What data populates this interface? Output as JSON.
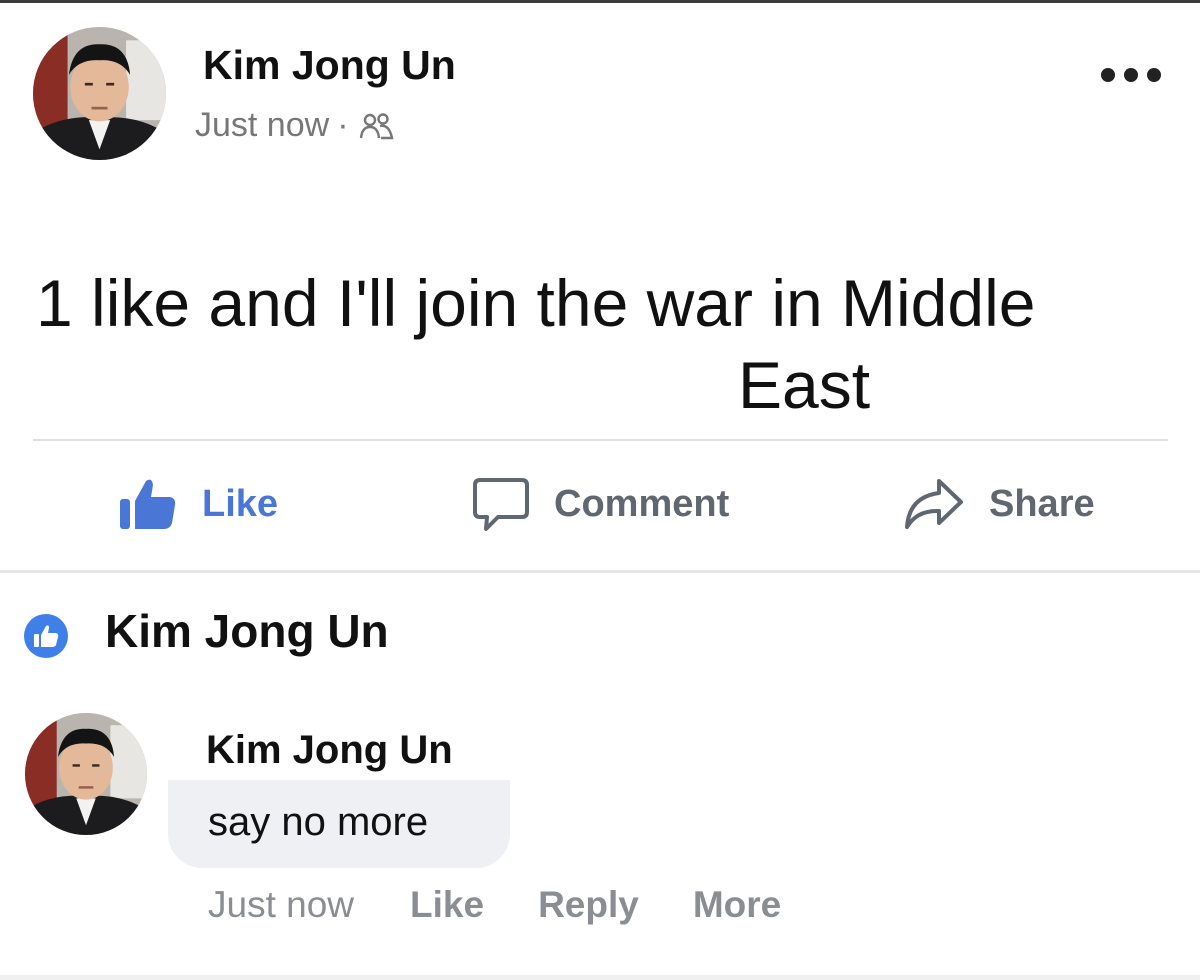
{
  "post": {
    "author": "Kim Jong Un",
    "timestamp": "Just now",
    "separator": "·",
    "audience_icon": "friends-icon",
    "text_line1": "1 like and I'll join the war in Middle",
    "text_line2": "East"
  },
  "actions": {
    "like": "Like",
    "comment": "Comment",
    "share": "Share"
  },
  "reactions": {
    "liker": "Kim Jong Un",
    "badge_color": "#3f80e8"
  },
  "comment": {
    "author": "Kim Jong Un",
    "text": "say no more",
    "timestamp": "Just now",
    "like": "Like",
    "reply": "Reply",
    "more": "More"
  },
  "colors": {
    "accent": "#4a76d6",
    "muted": "#606770"
  }
}
